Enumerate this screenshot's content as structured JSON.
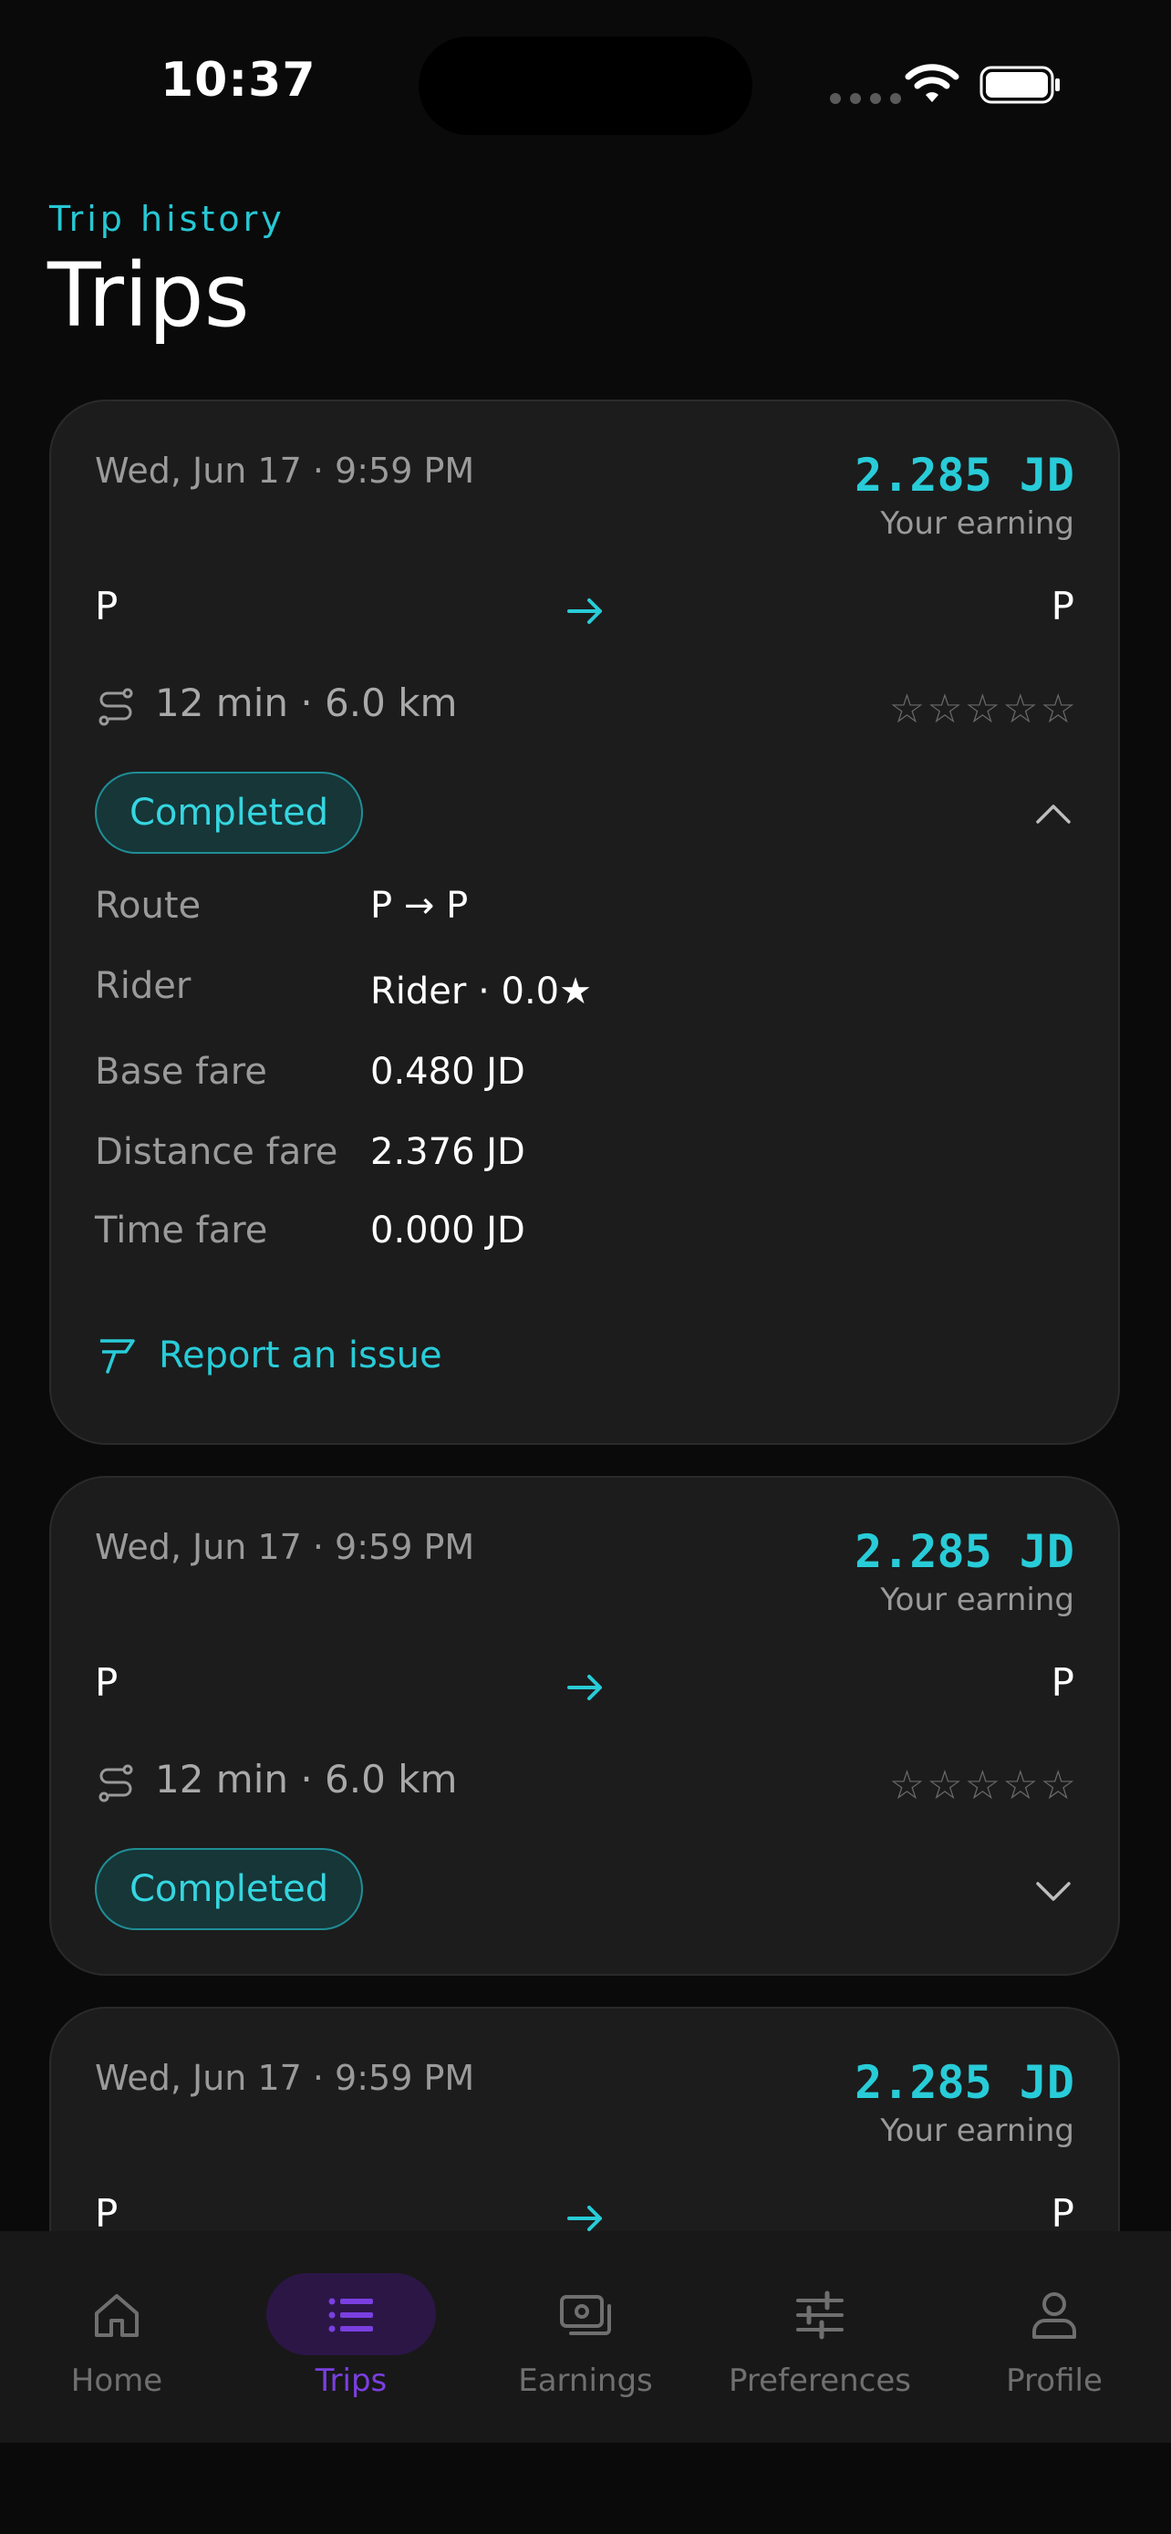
{
  "status_bar": {
    "time": "10:37"
  },
  "header": {
    "eyebrow": "Trip history",
    "title": "Trips"
  },
  "trips": [
    {
      "datetime": "Wed, Jun 17 · 9:59 PM",
      "amount": "2.285 JD",
      "amount_label": "Your earning",
      "from": "P",
      "to": "P",
      "meta": "12 min · 6.0 km",
      "rating_stars": 0,
      "status": "Completed",
      "expanded": true,
      "details": [
        {
          "label": "Route",
          "value": "P → P"
        },
        {
          "label": "Rider",
          "value": "Rider · 0.0★"
        },
        {
          "label": "Base fare",
          "value": "0.480 JD"
        },
        {
          "label": "Distance fare",
          "value": "2.376 JD"
        },
        {
          "label": "Time fare",
          "value": "0.000 JD"
        }
      ],
      "report_label": "Report an issue"
    },
    {
      "datetime": "Wed, Jun 17 · 9:59 PM",
      "amount": "2.285 JD",
      "amount_label": "Your earning",
      "from": "P",
      "to": "P",
      "meta": "12 min · 6.0 km",
      "rating_stars": 0,
      "status": "Completed",
      "expanded": false
    },
    {
      "datetime": "Wed, Jun 17 · 9:59 PM",
      "amount": "2.285 JD",
      "amount_label": "Your earning",
      "from": "P",
      "to": "P"
    }
  ],
  "tab_bar": {
    "active": "Trips",
    "tabs": [
      {
        "label": "Home",
        "icon": "home-icon"
      },
      {
        "label": "Trips",
        "icon": "list-icon"
      },
      {
        "label": "Earnings",
        "icon": "wallet-icon"
      },
      {
        "label": "Preferences",
        "icon": "sliders-icon"
      },
      {
        "label": "Profile",
        "icon": "person-icon"
      }
    ]
  },
  "colors": {
    "accent": "#28ccd8",
    "active_tab": "#7a3fe0",
    "background": "#0a0a0a",
    "card": "#1c1c1c"
  }
}
